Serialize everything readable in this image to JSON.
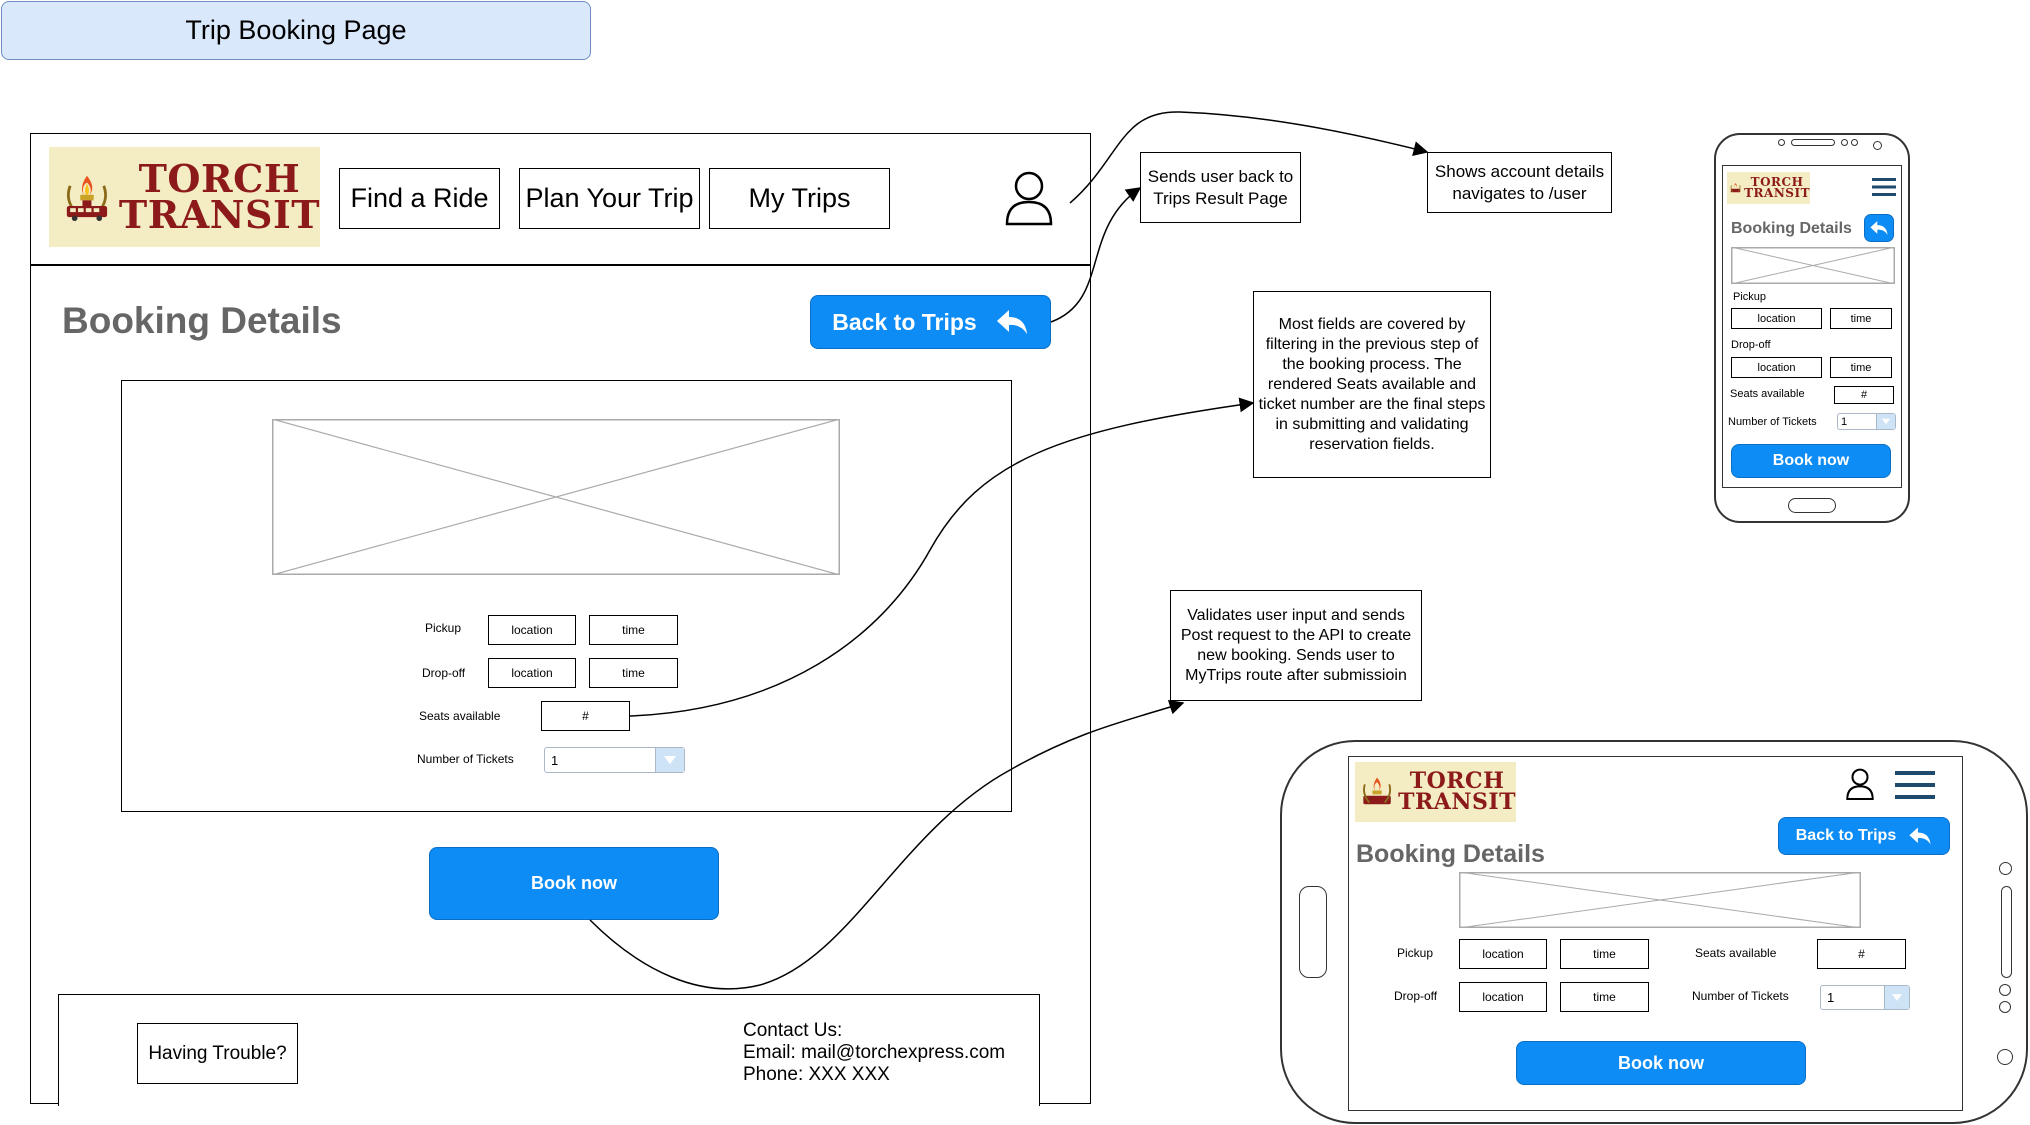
{
  "page_title": "Trip Booking Page",
  "desktop": {
    "logo": {
      "line1": "TORCH",
      "line2": "TRANSIT"
    },
    "nav": {
      "find_ride": "Find a Ride",
      "plan_trip": "Plan Your Trip",
      "my_trips": "My Trips"
    },
    "heading": "Booking Details",
    "back_button": "Back to Trips",
    "form": {
      "pickup_label": "Pickup",
      "dropoff_label": "Drop-off",
      "location_placeholder": "location",
      "time_placeholder": "time",
      "seats_label": "Seats available",
      "seats_value": "#",
      "tickets_label": "Number of Tickets",
      "tickets_value": "1"
    },
    "book_button": "Book now",
    "footer": {
      "trouble": "Having Trouble?",
      "contact_title": "Contact Us:",
      "email": "Email: mail@torchexpress.com",
      "phone": "Phone: XXX XXX"
    }
  },
  "notes": {
    "back_to_trips": "Sends user back to Trips Result Page",
    "account": "Shows account details navigates to /user",
    "fields": "Most fields are covered by filtering in the previous step of the booking process. The rendered Seats available and ticket number are the final steps in submitting and validating reservation fields.",
    "validate": "Validates user input and sends Post request to the API to create new booking. Sends user to MyTrips route after submissioin"
  },
  "mobile_portrait": {
    "logo": {
      "line1": "TORCH",
      "line2": "TRANSIT"
    },
    "heading": "Booking Details",
    "pickup_label": "Pickup",
    "dropoff_label": "Drop-off",
    "location_placeholder": "location",
    "time_placeholder": "time",
    "seats_label": "Seats available",
    "seats_value": "#",
    "tickets_label": "Number of Tickets",
    "tickets_value": "1",
    "book_button": "Book now"
  },
  "mobile_landscape": {
    "logo": {
      "line1": "TORCH",
      "line2": "TRANSIT"
    },
    "heading": "Booking Details",
    "back_button": "Back to Trips",
    "pickup_label": "Pickup",
    "dropoff_label": "Drop-off",
    "location_placeholder": "location",
    "time_placeholder": "time",
    "seats_label": "Seats available",
    "seats_value": "#",
    "tickets_label": "Number of Tickets",
    "tickets_value": "1",
    "book_button": "Book now"
  },
  "colors": {
    "title_fill": "#dae8fc",
    "title_border": "#6c8ebf",
    "button_blue": "#0e8cf5",
    "heading_gray": "#666666",
    "logo_background": "#f4ecc2",
    "logo_text": "#8c1a1a",
    "hamburger": "#1e4a6e"
  },
  "icons": [
    "user-icon",
    "reply-arrow-icon",
    "hamburger-icon",
    "dropdown-arrow-icon",
    "torch-logo-icon"
  ]
}
